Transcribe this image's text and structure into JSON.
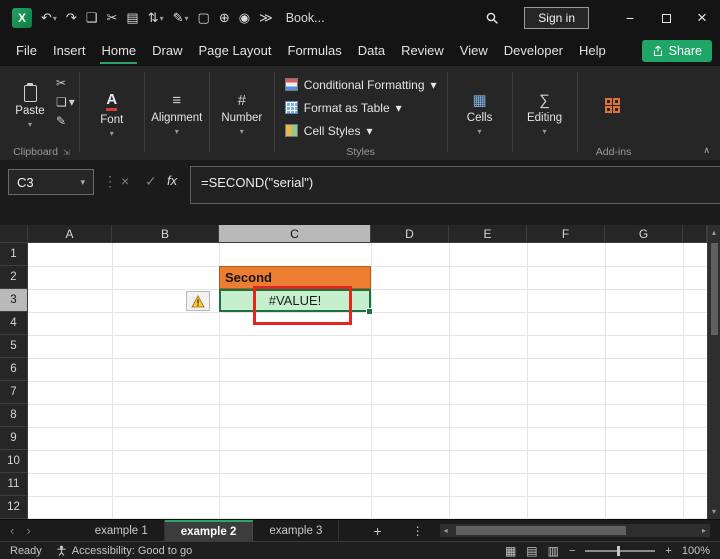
{
  "colors": {
    "excel_green": "#107C41",
    "share_green": "#1fa565",
    "selection_green": "#1a7240",
    "cell_orange": "#ED7D31",
    "cell_green": "#C6EFCE",
    "annotation_red": "#E52620",
    "dark_chrome": "#141414",
    "ribbon_bg": "#262626"
  },
  "icons": {
    "excel_logo": "X",
    "caret": "▾",
    "undo": "↶",
    "redo": "↷",
    "copy": "❏",
    "cut": "✂",
    "paste": "▤",
    "sort": "⇅",
    "format_painter": "✎",
    "new_doc": "▢",
    "insert": "⊕",
    "camera": "◉",
    "more": "≫",
    "minimize": "−",
    "close": "×",
    "dots": "⋮",
    "cancel": "×",
    "enter": "✓",
    "fx": "fx",
    "font": "A",
    "alignment": "≡",
    "number": "#",
    "cells": "▦",
    "editing": "∑",
    "collapse_ribbon": "∧",
    "scroll_up": "▴",
    "scroll_down": "▾",
    "scroll_left": "◂",
    "scroll_right": "▸",
    "tab_prev": "‹",
    "tab_next": "›",
    "add_sheet": "+",
    "kebab": "⋮",
    "view_normal": "▦",
    "view_layout": "▤",
    "view_break": "▥",
    "zoom_minus": "−",
    "zoom_plus": "+"
  },
  "titlebar": {
    "workbook_name": "Book...",
    "sign_in": "Sign in"
  },
  "menubar": {
    "tabs": [
      "File",
      "Insert",
      "Home",
      "Draw",
      "Page Layout",
      "Formulas",
      "Data",
      "Review",
      "View",
      "Developer",
      "Help"
    ],
    "active_tab": "Home",
    "share": "Share"
  },
  "ribbon": {
    "paste": "Paste",
    "clipboard_group": "Clipboard",
    "font": "Font",
    "alignment": "Alignment",
    "number": "Number",
    "styles_items": [
      "Conditional Formatting",
      "Format as Table",
      "Cell Styles"
    ],
    "styles_group": "Styles",
    "cells": "Cells",
    "editing": "Editing",
    "addins_group": "Add-ins"
  },
  "formula_bar": {
    "name_box": "C3",
    "formula": "=SECOND(\"serial\")"
  },
  "grid": {
    "columns": [
      "A",
      "B",
      "C",
      "D",
      "E",
      "F",
      "G"
    ],
    "rows": [
      "1",
      "2",
      "3",
      "4",
      "5",
      "6",
      "7",
      "8",
      "9",
      "10",
      "11",
      "12"
    ],
    "selected_column": "C",
    "selected_row": "3",
    "cells": {
      "C2": {
        "text": "Second"
      },
      "C3": {
        "text": "#VALUE!"
      }
    }
  },
  "sheet_tabs": {
    "tabs": [
      "example 1",
      "example 2",
      "example 3"
    ],
    "active": "example 2"
  },
  "status_bar": {
    "ready": "Ready",
    "accessibility": "Accessibility: Good to go",
    "zoom": "100%"
  }
}
